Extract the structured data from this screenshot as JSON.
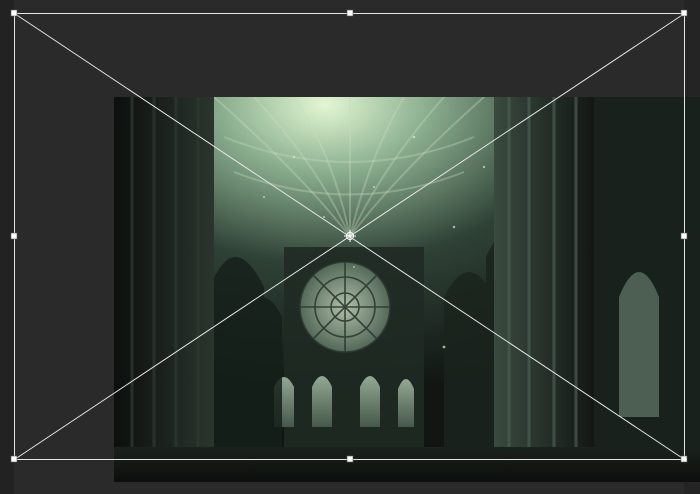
{
  "app": {
    "tool": "free-transform",
    "pasteboard_color": "#2a2a2a"
  },
  "layer": {
    "content": "cathedral-nave-photo",
    "tint": "#7fa58a",
    "light_color": "#d7f3c8"
  },
  "transform_box": {
    "stroke_color": "#e6e6e6",
    "handle_fill": "#ffffff",
    "handles": [
      "top-left",
      "top-center",
      "top-right",
      "middle-left",
      "middle-right",
      "bottom-left",
      "bottom-center",
      "bottom-right"
    ],
    "center_marker": "reference-point-icon"
  }
}
